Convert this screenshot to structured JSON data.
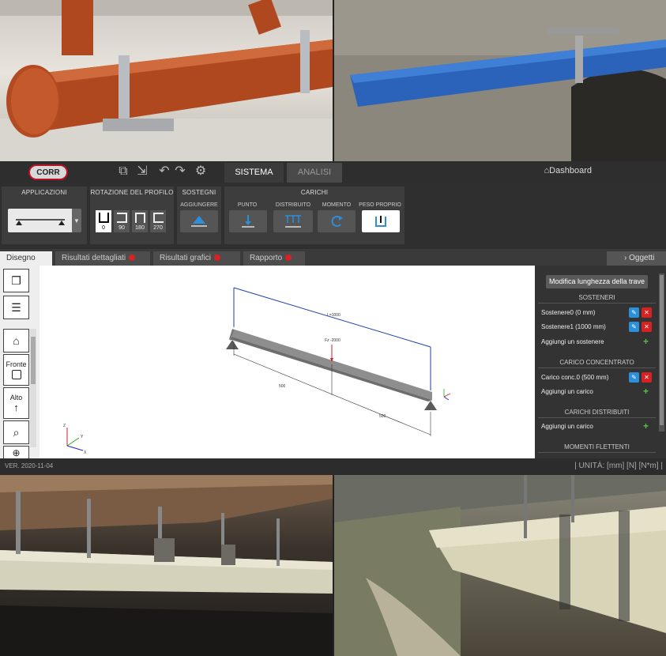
{
  "topbar": {
    "logo_text": "CORR",
    "tabs": [
      {
        "label": "SISTEMA"
      },
      {
        "label": "ANALISI"
      }
    ],
    "dashboard_label": "Dashboard"
  },
  "ribbon": {
    "applicazioni": {
      "title": "APPLICAZIONI"
    },
    "rotazione": {
      "title": "ROTAZIONE DEL PROFILO",
      "values": [
        "0",
        "90",
        "180",
        "270"
      ]
    },
    "sostegni": {
      "title": "SOSTEGNI",
      "add_label": "AGGIUNGERE"
    },
    "carichi": {
      "title": "CARICHI",
      "labels": [
        "PUNTO",
        "DISTRIBUITO",
        "MOMENTO",
        "PESO PROPRIO"
      ]
    }
  },
  "worktabs": [
    {
      "label": "Disegno"
    },
    {
      "label": "Risultati dettagliati"
    },
    {
      "label": "Risultati grafici"
    },
    {
      "label": "Rapporto"
    }
  ],
  "oggetti_label": "Oggetti",
  "left_toolbar": {
    "fronte_label": "Fronte",
    "alto_label": "Alto"
  },
  "canvas": {
    "length_label": "L=1000",
    "force_label": "Fz -2000",
    "dim_left": "500",
    "dim_right": "500",
    "axis_x": "X",
    "axis_y": "Y",
    "axis_z": "Z"
  },
  "panel": {
    "modify_button": "Modifica lunghezza della trave",
    "sostegni_title": "SOSTENERI",
    "sostegni_items": [
      "Sostenere0 (0 mm)",
      "Sostenere1 (1000 mm)"
    ],
    "add_support": "Aggiungi un sostenere",
    "carico_title": "CARICO CONCENTRATO",
    "carico_items": [
      "Carico conc.0 (500 mm)"
    ],
    "add_load": "Aggiungi un carico",
    "distr_title": "CARICHI DISTRIBUITI",
    "add_distr": "Aggiungi un carico",
    "momenti_title": "MOMENTI FLETTENTI"
  },
  "status": {
    "version": "VER. 2020-11-04",
    "units": "| UNITÀ: [mm] [N] [N*m] |"
  },
  "colors": {
    "accent_blue": "#2b8fd9",
    "delete_red": "#d62222",
    "add_green": "#5bbd46",
    "dimension_blue": "#1f3fa8"
  }
}
